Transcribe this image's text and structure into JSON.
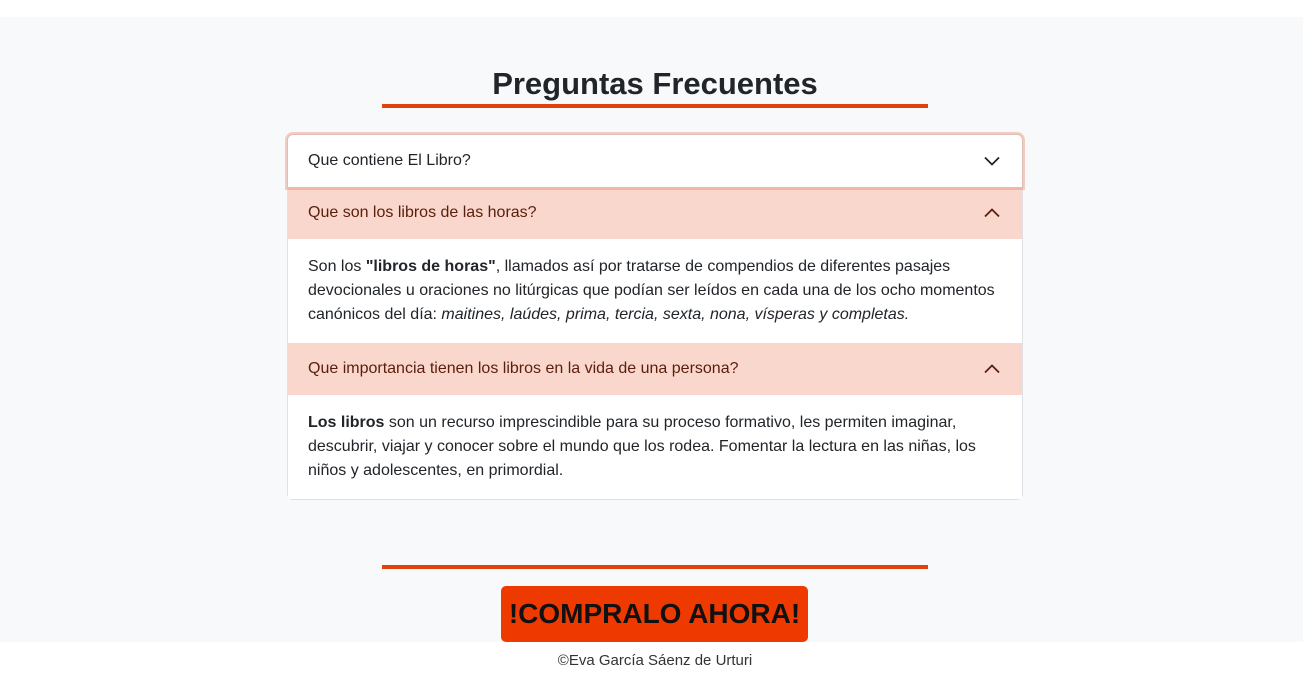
{
  "faq": {
    "title": "Preguntas Frecuentes",
    "items": [
      {
        "question": "Que contiene El Libro?",
        "expanded": false
      },
      {
        "question": "Que son los libros de las horas?",
        "expanded": true,
        "answer": {
          "intro": "Son los ",
          "bold": "\"libros de horas\"",
          "middle": ", llamados así por tratarse de compendios de diferentes pasajes devocionales u oraciones no litúrgicas que podían ser leídos en cada una de los ocho momentos canónicos del día: ",
          "italic": "maitines, laúdes, prima, tercia, sexta, nona, vísperas y completas."
        }
      },
      {
        "question": "Que importancia tienen los libros en la vida de una persona?",
        "expanded": true,
        "answer": {
          "bold": "Los libros",
          "rest": " son un recurso imprescindible para su proceso formativo, les permiten imaginar, descubrir, viajar y conocer sobre el mundo que los rodea. Fomentar la lectura en las niñas, los niños y adolescentes, en primordial."
        }
      }
    ]
  },
  "cta": {
    "label": "!COMPRALO AHORA!"
  },
  "footer": {
    "text": "©Eva García Sáenz de Urturi"
  },
  "icons": {
    "collapsed": "chevron-down-icon",
    "expanded": "chevron-up-icon"
  },
  "colors": {
    "accent": "#e2410b",
    "cta_background": "#ee3a00",
    "open_header_background": "#fad7cc",
    "section_background": "#f8f9fa"
  }
}
